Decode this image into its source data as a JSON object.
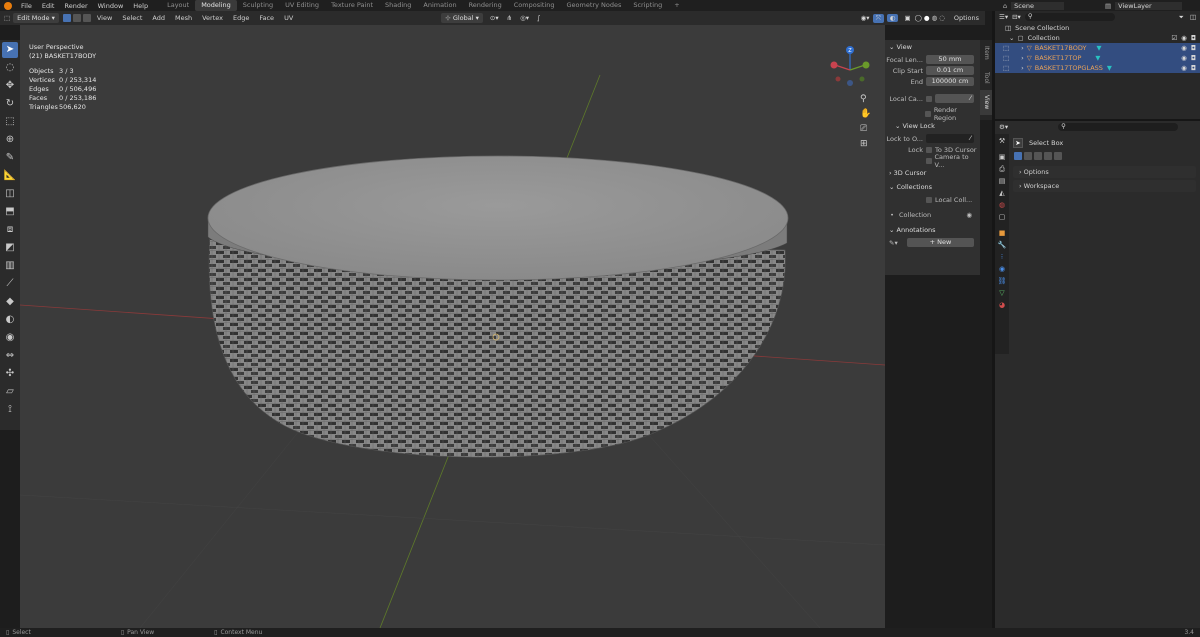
{
  "topbar": {
    "menus": [
      "File",
      "Edit",
      "Render",
      "Window",
      "Help"
    ],
    "workspaces": [
      "Layout",
      "Modeling",
      "Sculpting",
      "UV Editing",
      "Texture Paint",
      "Shading",
      "Animation",
      "Rendering",
      "Compositing",
      "Geometry Nodes",
      "Scripting"
    ],
    "active_workspace": "Modeling",
    "add_tab": "+",
    "scene": "Scene",
    "view_layer": "ViewLayer"
  },
  "header": {
    "mode": "Edit Mode",
    "menus": [
      "View",
      "Select",
      "Add",
      "Mesh",
      "Vertex",
      "Edge",
      "Face",
      "UV"
    ],
    "orientation": "Global",
    "options": "Options"
  },
  "overlay": {
    "perspective": "User Perspective",
    "object": "(21) BASKET17BODY",
    "stats": [
      {
        "label": "Objects",
        "value": "3 / 3"
      },
      {
        "label": "Vertices",
        "value": "0 / 253,314"
      },
      {
        "label": "Edges",
        "value": "0 / 506,496"
      },
      {
        "label": "Faces",
        "value": "0 / 253,186"
      },
      {
        "label": "Triangles",
        "value": "506,620"
      }
    ]
  },
  "gizmo": {
    "x": "X",
    "y": "Y",
    "z": "Z"
  },
  "npanel": {
    "view_header": "View",
    "focal_label": "Focal Len...",
    "focal_value": "50 mm",
    "clip_start_label": "Clip Start",
    "clip_start_value": "0.01 cm",
    "clip_end_label": "End",
    "clip_end_value": "100000 cm",
    "local_camera_label": "Local Ca...",
    "render_region": "Render Region",
    "view_lock_header": "View Lock",
    "lock_to_label": "Lock to O...",
    "lock_label": "Lock",
    "to_3d_cursor": "To 3D Cursor",
    "camera_to_view": "Camera to V...",
    "cursor_header": "3D Cursor",
    "collections_header": "Collections",
    "local_coll": "Local Coll...",
    "collection_label": "Collection",
    "annotations_header": "Annotations",
    "new_btn": "New",
    "tabs": [
      "Item",
      "Tool",
      "View"
    ],
    "active_tab": "View"
  },
  "outliner": {
    "scene_collection": "Scene Collection",
    "collection": "Collection",
    "objects": [
      "BASKET17BODY",
      "BASKET17TOP",
      "BASKET17TOPGLASS"
    ]
  },
  "properties": {
    "tool_name": "Select Box",
    "panels": [
      "Options",
      "Workspace"
    ]
  },
  "statusbar": {
    "items": [
      "Select",
      "Pan View",
      "Context Menu"
    ],
    "version": "3.4"
  },
  "colors": {
    "accent": "#4772b3",
    "selection": "#334d80",
    "object_name": "#e8a25a",
    "viewport": "#3b3b3b"
  }
}
